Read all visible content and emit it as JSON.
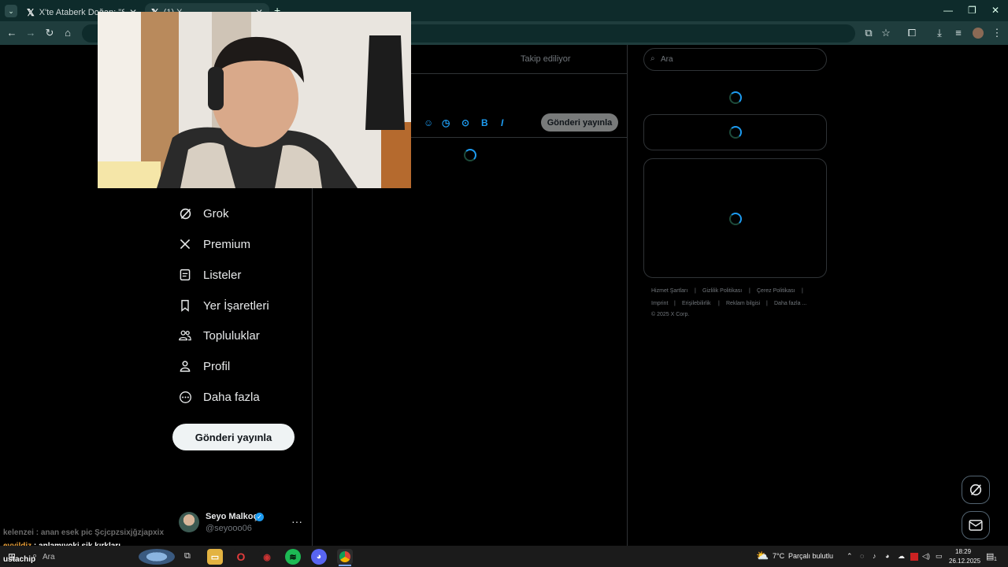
{
  "browser": {
    "tabs": [
      {
        "title": "X'te Ataberk Doğan: \"Selamlar",
        "active": false
      },
      {
        "title": "(1) X",
        "active": true
      }
    ],
    "new_tab": "+",
    "window_controls": {
      "minimize": "—",
      "restore": "❐",
      "close": "✕"
    }
  },
  "sidebar": {
    "items": [
      {
        "label": "Grok",
        "icon": "grok-icon"
      },
      {
        "label": "Premium",
        "icon": "x-logo-icon"
      },
      {
        "label": "Listeler",
        "icon": "list-icon"
      },
      {
        "label": "Yer İşaretleri",
        "icon": "bookmark-icon"
      },
      {
        "label": "Topluluklar",
        "icon": "communities-icon"
      },
      {
        "label": "Profil",
        "icon": "person-icon"
      },
      {
        "label": "Daha fazla",
        "icon": "more-circle-icon"
      }
    ],
    "post_button": "Gönderi yayınla",
    "account": {
      "name": "Seyo Malkoç",
      "handle": "@seyooo06",
      "more": "···"
    }
  },
  "main": {
    "tab_following": "Takip ediliyor",
    "compose_post": "Gönderi yayınla"
  },
  "right": {
    "search_placeholder": "Ara",
    "footer": {
      "links": [
        "Hizmet Şartları",
        "Gizlilik Politikası",
        "Çerez Politikası",
        "Imprint",
        "Erişilebilirlik",
        "Reklam bilgisi",
        "Daha fazla ..."
      ],
      "copyright": "© 2025 X Corp."
    }
  },
  "chat": [
    {
      "user": "kelenzei",
      "message": "anan esek pic Şcjcpzsixjğzjapxix",
      "color": "#6b6b6b"
    },
    {
      "user": "eyyildiz",
      "message": "anlamıyoki sik kırkları",
      "color": "#f0a43a"
    },
    {
      "user": "ustachip",
      "message": "",
      "color": "#ffffff"
    }
  ],
  "taskbar": {
    "search_text": "Ara",
    "weather": {
      "temp": "7°C",
      "condition": "Parçalı bulutlu"
    },
    "time": "18:29",
    "date": "26.12.2025",
    "notification_count": "1"
  },
  "colors": {
    "accent": "#1d9bf0",
    "background": "#000000",
    "border": "#2f3336",
    "muted": "#71767b"
  }
}
